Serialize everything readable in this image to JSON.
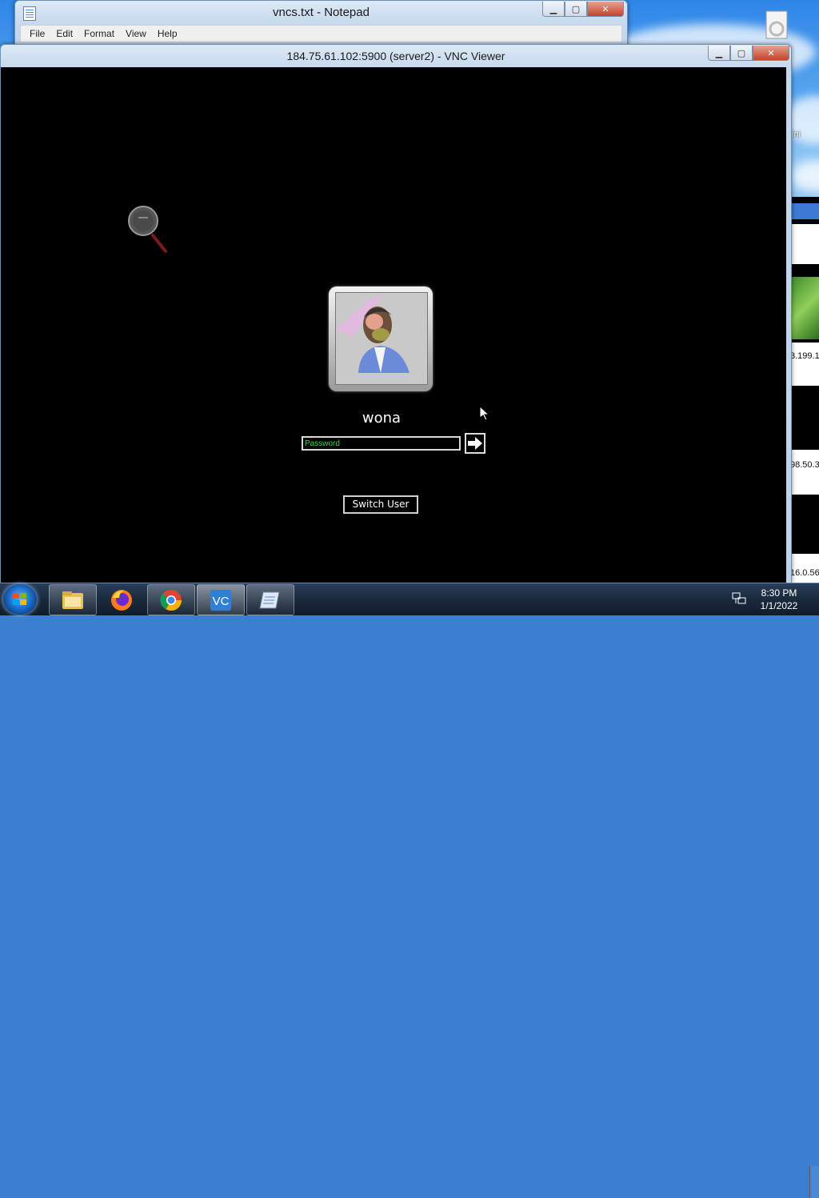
{
  "notepad": {
    "title": "vncs.txt - Notepad",
    "menu": [
      "File",
      "Edit",
      "Format",
      "View",
      "Help"
    ],
    "icon": "notepad-icon"
  },
  "vnc": {
    "title": "184.75.61.102:5900 (server2) - VNC Viewer"
  },
  "login": {
    "username": "wona",
    "password_placeholder": "Password",
    "submit_icon": "arrow-right-icon",
    "switch_user_label": "Switch User"
  },
  "background": {
    "desktop_icon_label": "ini",
    "ip_fragments": [
      "3.199.1",
      "98.50.3",
      "16.0.56"
    ]
  },
  "taskbar": {
    "buttons": [
      "explorer-icon",
      "firefox-icon",
      "chrome-icon",
      "vnc-viewer-icon",
      "notepad-icon"
    ],
    "time": "8:30 PM",
    "date": "1/1/2022"
  },
  "colors": {
    "password_text": "#3fd33f",
    "remote_background": "#000000"
  }
}
